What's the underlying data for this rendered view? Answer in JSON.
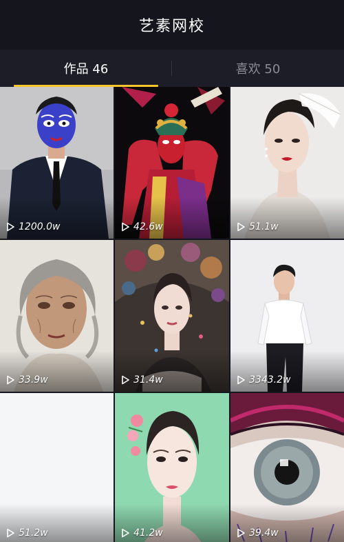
{
  "header": {
    "title": "艺素网校"
  },
  "tabs": [
    {
      "label": "作品 46",
      "active": true
    },
    {
      "label": "喜欢 50",
      "active": false
    }
  ],
  "colors": {
    "accent": "#f7c52c",
    "background": "#14151d",
    "tab_bar": "#1c1d27"
  },
  "videos": [
    {
      "views": "1200.0w",
      "icon": "play-icon"
    },
    {
      "views": "42.6w",
      "icon": "play-icon"
    },
    {
      "views": "51.1w",
      "icon": "play-icon"
    },
    {
      "views": "33.9w",
      "icon": "play-icon"
    },
    {
      "views": "31.4w",
      "icon": "play-icon"
    },
    {
      "views": "3343.2w",
      "icon": "play-icon"
    },
    {
      "views": "51.2w",
      "icon": "play-icon"
    },
    {
      "views": "41.2w",
      "icon": "play-icon"
    },
    {
      "views": "39.4w",
      "icon": "play-icon"
    }
  ]
}
